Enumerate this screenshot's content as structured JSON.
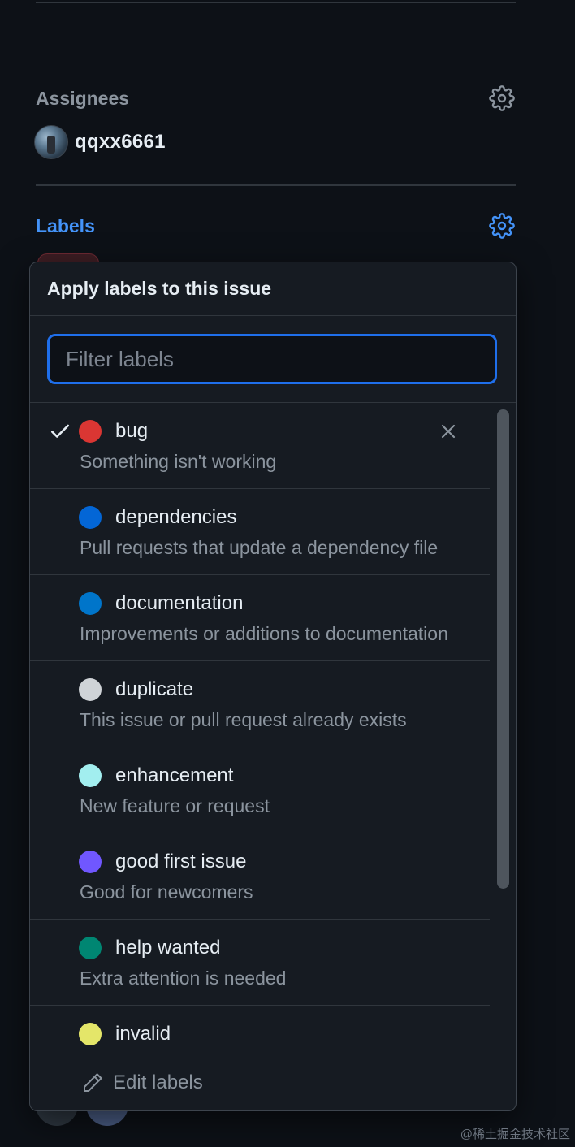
{
  "assignees": {
    "title": "Assignees",
    "user": "qqxx6661",
    "settings_icon": "gear-icon"
  },
  "labels_section": {
    "title": "Labels",
    "settings_icon": "gear-icon"
  },
  "popover": {
    "title": "Apply labels to this issue",
    "filter_placeholder": "Filter labels",
    "filter_value": "",
    "items": [
      {
        "name": "bug",
        "description": "Something isn't working",
        "color": "#da3633",
        "selected": true
      },
      {
        "name": "dependencies",
        "description": "Pull requests that update a dependency file",
        "color": "#0366d6",
        "selected": false
      },
      {
        "name": "documentation",
        "description": "Improvements or additions to documentation",
        "color": "#0075ca",
        "selected": false
      },
      {
        "name": "duplicate",
        "description": "This issue or pull request already exists",
        "color": "#cfd3d7",
        "selected": false
      },
      {
        "name": "enhancement",
        "description": "New feature or request",
        "color": "#a2eeef",
        "selected": false
      },
      {
        "name": "good first issue",
        "description": "Good for newcomers",
        "color": "#7057ff",
        "selected": false
      },
      {
        "name": "help wanted",
        "description": "Extra attention is needed",
        "color": "#008672",
        "selected": false
      },
      {
        "name": "invalid",
        "description": "",
        "color": "#e4e669",
        "selected": false
      }
    ],
    "footer_label": "Edit labels",
    "footer_icon": "pencil-icon"
  },
  "watermark": "@稀土掘金技术社区",
  "colors": {
    "background": "#0d1117",
    "accent": "#4493f8",
    "focus_border": "#1f6feb"
  }
}
